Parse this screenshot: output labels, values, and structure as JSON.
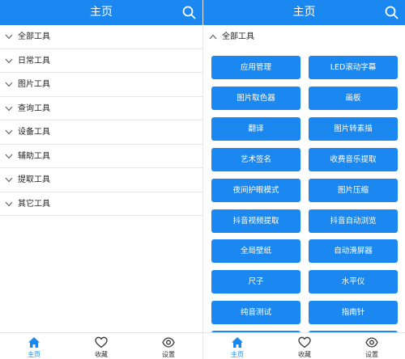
{
  "colors": {
    "primary": "#1a88f0",
    "text": "#222222",
    "divider": "#e8e8e8"
  },
  "left": {
    "title": "主页",
    "categories": [
      {
        "label": "全部工具"
      },
      {
        "label": "日常工具"
      },
      {
        "label": "图片工具"
      },
      {
        "label": "查询工具"
      },
      {
        "label": "设备工具"
      },
      {
        "label": "辅助工具"
      },
      {
        "label": "提取工具"
      },
      {
        "label": "其它工具"
      }
    ]
  },
  "right": {
    "title": "主页",
    "expanded_category": "全部工具",
    "tools": [
      "应用管理",
      "LED滚动字幕",
      "图片取色器",
      "画板",
      "翻译",
      "图片转素描",
      "艺术签名",
      "收费音乐提取",
      "夜间护眼模式",
      "图片压缩",
      "抖音视频提取",
      "抖音自动浏览",
      "全局壁纸",
      "自动滑屏器",
      "尺子",
      "水平仪",
      "纯音测试",
      "指南针",
      "",
      ""
    ]
  },
  "nav": {
    "items": [
      {
        "label": "主页",
        "icon": "home-icon",
        "active": true
      },
      {
        "label": "收藏",
        "icon": "heart-icon",
        "active": false
      },
      {
        "label": "设置",
        "icon": "eye-icon",
        "active": false
      }
    ]
  }
}
